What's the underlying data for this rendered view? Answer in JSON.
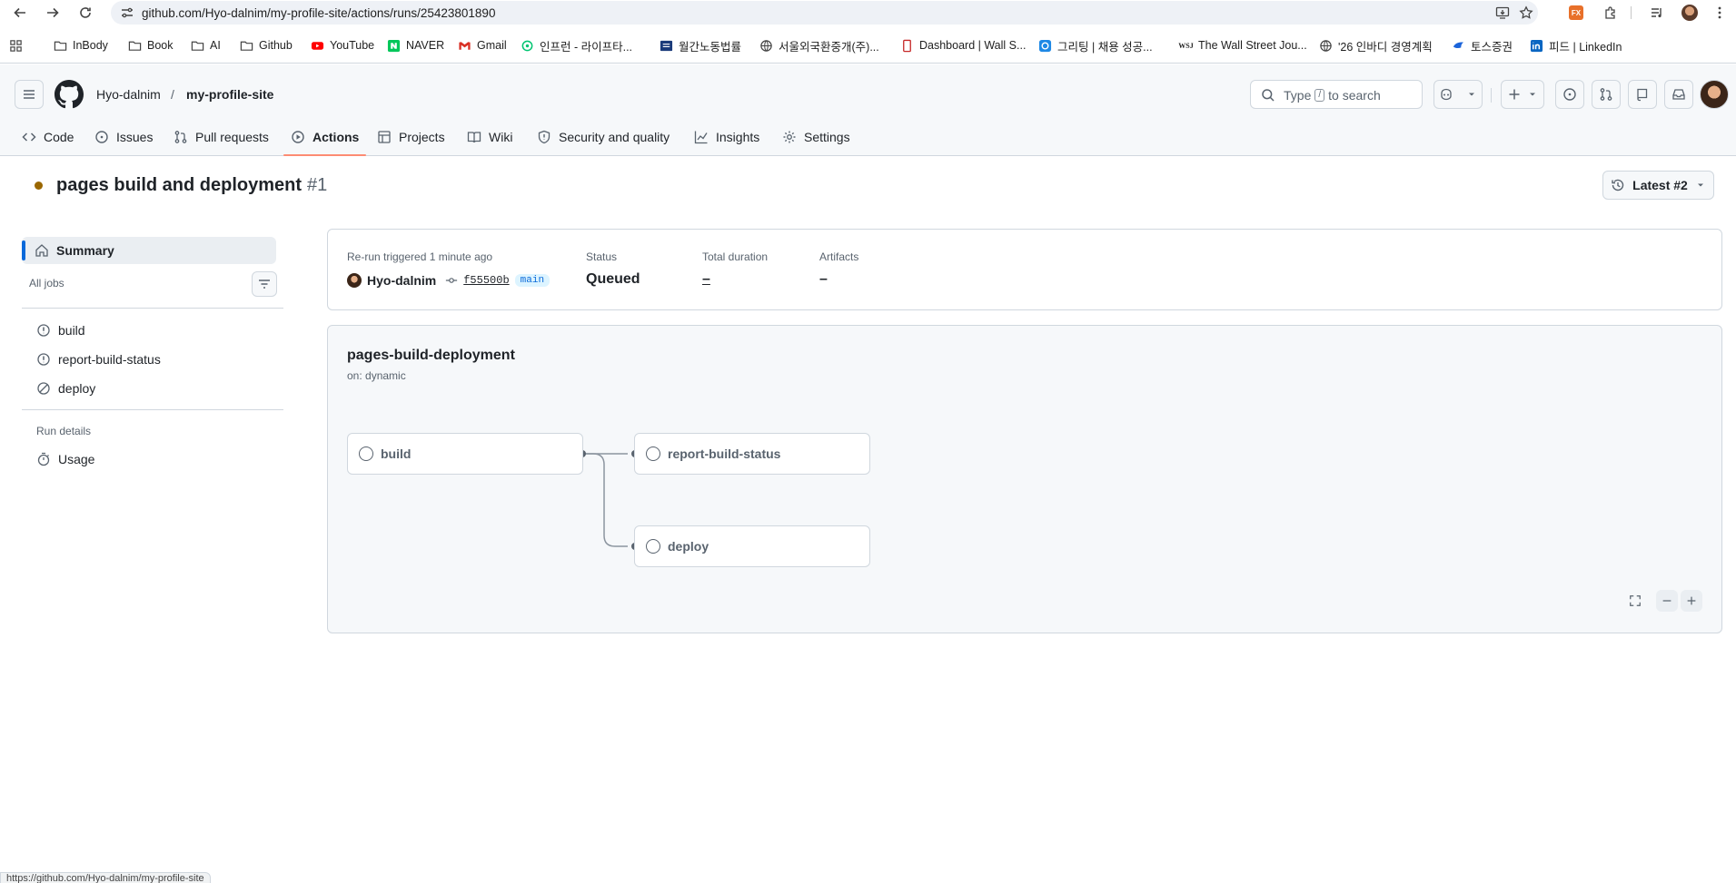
{
  "browser": {
    "url": "github.com/Hyo-dalnim/my-profile-site/actions/runs/25423801890",
    "status_url": "https://github.com/Hyo-dalnim/my-profile-site",
    "ext_badge": "FX",
    "bookmarks": [
      {
        "label": "InBody",
        "icon": "folder-icon"
      },
      {
        "label": "Book",
        "icon": "folder-icon"
      },
      {
        "label": "AI",
        "icon": "folder-icon"
      },
      {
        "label": "Github",
        "icon": "folder-icon"
      },
      {
        "label": "YouTube",
        "icon": "youtube-icon"
      },
      {
        "label": "NAVER",
        "icon": "naver-icon"
      },
      {
        "label": "Gmail",
        "icon": "gmail-icon"
      },
      {
        "label": "인프런 - 라이프타...",
        "icon": "inflearn-icon"
      },
      {
        "label": "월간노동법률",
        "icon": "site-icon"
      },
      {
        "label": "서울외국환중개(주)...",
        "icon": "globe-icon"
      },
      {
        "label": "Dashboard | Wall S...",
        "icon": "site-icon"
      },
      {
        "label": "그리팅 | 채용 성공...",
        "icon": "greeting-icon"
      },
      {
        "label": "The Wall Street Jou...",
        "icon": "wsj-icon"
      },
      {
        "label": "'26 인바디 경영계획",
        "icon": "globe-icon"
      },
      {
        "label": "토스증권",
        "icon": "toss-icon"
      },
      {
        "label": "피드 | LinkedIn",
        "icon": "linkedin-icon"
      }
    ]
  },
  "header": {
    "owner": "Hyo-dalnim",
    "separator": "/",
    "repo": "my-profile-site",
    "search_prefix": "Type",
    "search_key": "/",
    "search_suffix": "to search"
  },
  "tabs": [
    {
      "label": "Code",
      "icon": "code-icon"
    },
    {
      "label": "Issues",
      "icon": "issue-icon"
    },
    {
      "label": "Pull requests",
      "icon": "pull-request-icon"
    },
    {
      "label": "Actions",
      "icon": "play-icon",
      "active": true
    },
    {
      "label": "Projects",
      "icon": "table-icon"
    },
    {
      "label": "Wiki",
      "icon": "book-icon"
    },
    {
      "label": "Security and quality",
      "icon": "shield-icon"
    },
    {
      "label": "Insights",
      "icon": "graph-icon"
    },
    {
      "label": "Settings",
      "icon": "gear-icon"
    }
  ],
  "run": {
    "title": "pages build and deployment",
    "number": "#1",
    "status_color": "#9a6700",
    "latest_label": "Latest #2"
  },
  "sidebar": {
    "summary": "Summary",
    "all_jobs": "All jobs",
    "jobs": [
      {
        "label": "build",
        "icon": "alert-circle-icon"
      },
      {
        "label": "report-build-status",
        "icon": "alert-circle-icon"
      },
      {
        "label": "deploy",
        "icon": "skip-icon"
      }
    ],
    "run_details": "Run details",
    "usage": "Usage"
  },
  "summary": {
    "trigger_label": "Re-run triggered 1 minute ago",
    "actor": "Hyo-dalnim",
    "commit_sha": "f55500b",
    "branch": "main",
    "status_label": "Status",
    "status_value": "Queued",
    "duration_label": "Total duration",
    "duration_value": "–",
    "artifacts_label": "Artifacts",
    "artifacts_value": "–"
  },
  "workflow": {
    "name": "pages-build-deployment",
    "trigger": "on: dynamic",
    "jobs": {
      "build": "build",
      "report": "report-build-status",
      "deploy": "deploy"
    }
  },
  "colors": {
    "accent": "#0969da",
    "tab_underline": "#fd8c73",
    "queued": "#9a6700"
  }
}
